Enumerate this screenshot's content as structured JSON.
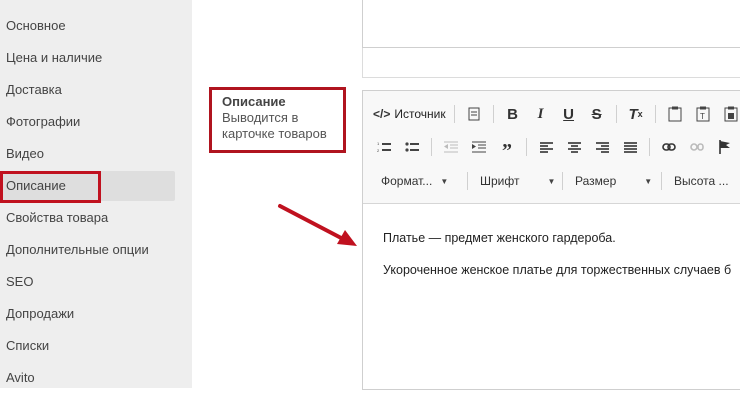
{
  "sidebar": {
    "items": [
      {
        "label": "Основное"
      },
      {
        "label": "Цена и наличие"
      },
      {
        "label": "Доставка"
      },
      {
        "label": "Фотографии"
      },
      {
        "label": "Видео"
      },
      {
        "label": "Описание",
        "active": true
      },
      {
        "label": "Свойства товара"
      },
      {
        "label": "Дополнительные опции"
      },
      {
        "label": "SEO"
      },
      {
        "label": "Допродажи"
      },
      {
        "label": "Списки"
      },
      {
        "label": "Avito"
      }
    ]
  },
  "field": {
    "title": "Описание",
    "hint": "Выводится в карточке товаров"
  },
  "toolbar": {
    "source_label": "Источник",
    "format_label": "Формат...",
    "font_label": "Шрифт",
    "size_label": "Размер",
    "height_label": "Высота ..."
  },
  "editor": {
    "paragraphs": [
      "Платье — предмет женского гардероба.",
      "Укороченное женское платье для торжественных случаев б"
    ]
  },
  "colors": {
    "highlight": "#c0111f",
    "sidebar_bg": "#eeeeee",
    "active_bg": "#dedede"
  }
}
